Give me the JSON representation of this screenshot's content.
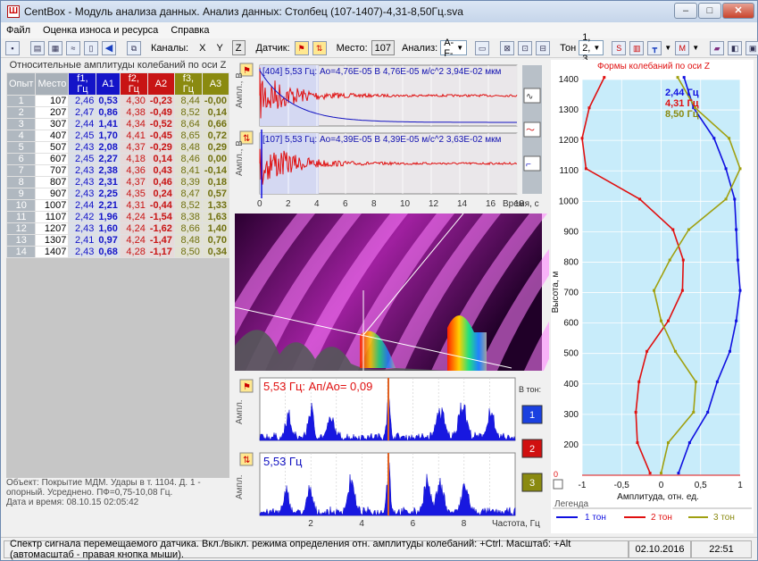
{
  "window": {
    "title": "CentBox - Модуль анализа данных. Анализ данных: Столбец (107-1407)-4,31-8,50Гц.sva",
    "app_icon": "Ш"
  },
  "menu": [
    "Файл",
    "Оценка износа и ресурса",
    "Справка"
  ],
  "toolbar": {
    "channels_label": "Каналы:",
    "ch_x": "X",
    "ch_y": "Y",
    "ch_z": "Z",
    "sensor_label": "Датчик:",
    "place_label": "Место:",
    "place_value": "107",
    "analysis_label": "Анализ:",
    "analysis_value": "A-F-",
    "tone_label": "Тон",
    "tone_value": "1, 2, 3"
  },
  "table": {
    "caption": "Относительные амплитуды колебаний по оси Z",
    "headers": [
      "Опыт",
      "Место",
      "f1, Гц",
      "A1",
      "f2, Гц",
      "A2",
      "f3, Гц",
      "A3"
    ],
    "rows": [
      [
        "1",
        "107",
        "2,46",
        "0,53",
        "4,30",
        "-0,23",
        "8,44",
        "-0,00"
      ],
      [
        "2",
        "207",
        "2,47",
        "0,86",
        "4,38",
        "-0,49",
        "8,52",
        "0,14"
      ],
      [
        "3",
        "307",
        "2,44",
        "1,41",
        "4,34",
        "-0,52",
        "8,64",
        "0,66"
      ],
      [
        "4",
        "407",
        "2,45",
        "1,70",
        "4,41",
        "-0,45",
        "8,65",
        "0,72"
      ],
      [
        "5",
        "507",
        "2,43",
        "2,08",
        "4,37",
        "-0,29",
        "8,48",
        "0,29"
      ],
      [
        "6",
        "607",
        "2,45",
        "2,27",
        "4,18",
        "0,14",
        "8,46",
        "0,00"
      ],
      [
        "7",
        "707",
        "2,43",
        "2,38",
        "4,36",
        "0,43",
        "8,41",
        "-0,14"
      ],
      [
        "8",
        "807",
        "2,43",
        "2,31",
        "4,37",
        "0,46",
        "8,39",
        "0,18"
      ],
      [
        "9",
        "907",
        "2,43",
        "2,25",
        "4,35",
        "0,24",
        "8,47",
        "0,57"
      ],
      [
        "10",
        "1007",
        "2,44",
        "2,21",
        "4,31",
        "-0,44",
        "8,52",
        "1,33"
      ],
      [
        "11",
        "1107",
        "2,42",
        "1,96",
        "4,24",
        "-1,54",
        "8,38",
        "1,63"
      ],
      [
        "12",
        "1207",
        "2,43",
        "1,60",
        "4,24",
        "-1,62",
        "8,66",
        "1,40"
      ],
      [
        "13",
        "1307",
        "2,41",
        "0,97",
        "4,24",
        "-1,47",
        "8,48",
        "0,70"
      ],
      [
        "14",
        "1407",
        "2,43",
        "0,68",
        "4,28",
        "-1,17",
        "8,50",
        "0,34"
      ]
    ]
  },
  "info": {
    "object": "Объект: Покрытие МДМ. Удары в т. 1104. Д. 1 - опорный. Усреднено. ПФ=0,75-10,08 Гц.",
    "datetime": "Дата и время: 08.10.15  02:05:42"
  },
  "wave": {
    "ylabel": "Ампл., В",
    "top_info": "[404] 5,53 Гц:  Ао=4,76Е-05  В    4,76Е-05  м/с^2    3,94Е-02  мкм",
    "bottom_info": "[107] 5,53 Гц:  Ао=4,39Е-05  В    4,39Е-05  м/с^2    3,63Е-02  мкм",
    "xticks": [
      "0",
      "2",
      "4",
      "6",
      "8",
      "10",
      "12",
      "14",
      "16",
      "18"
    ],
    "xlabel": "Время, с"
  },
  "spectrum": {
    "ylabel": "Ампл.",
    "top_info": "5,53 Гц:  Ап/Ао= 0,09",
    "bottom_info": "5,53 Гц",
    "xticks": [
      "2",
      "4",
      "6",
      "8"
    ],
    "xlabel": "Частота, Гц",
    "tone_label": "В тон:",
    "tone_buttons": [
      "1",
      "2",
      "3"
    ]
  },
  "modes": {
    "title": "Формы колебаний по оси Z",
    "ylabel": "Высота, м",
    "xlabel": "Амплитуда, отн. ед.",
    "freqs": [
      "2,44 Гц",
      "4,31 Гц",
      "8,50 Гц"
    ],
    "zero": "0",
    "legend_label": "Легенда",
    "legend": [
      "1 тон",
      "2 тон",
      "3 тон"
    ],
    "yticks": [
      "1400",
      "1300",
      "1200",
      "1100",
      "1000",
      "900",
      "800",
      "700",
      "600",
      "500",
      "400",
      "300",
      "200"
    ],
    "xticks": [
      "-1",
      "-0,5",
      "0",
      "0,5",
      "1"
    ]
  },
  "status": {
    "hint": "Спектр сигнала перемещаемого датчика. Вкл./выкл. режима определения отн. амплитуды колебаний: +Ctrl. Масштаб: +Alt (автомасштаб - правая кнопка мыши).",
    "date": "02.10.2016",
    "time": "22:51"
  },
  "chart_data": {
    "type": "line",
    "title": "Формы колебаний по оси Z",
    "xlabel": "Амплитуда, отн. ед.",
    "ylabel": "Высота, м",
    "xlim": [
      -1,
      1
    ],
    "ylim": [
      100,
      1400
    ],
    "heights": [
      107,
      207,
      307,
      407,
      507,
      607,
      707,
      807,
      907,
      1007,
      1107,
      1207,
      1307,
      1407
    ],
    "series": [
      {
        "name": "1 тон",
        "color": "#1010e0",
        "values": [
          0.22,
          0.36,
          0.59,
          0.71,
          0.87,
          0.95,
          1.0,
          0.97,
          0.95,
          0.93,
          0.82,
          0.67,
          0.41,
          0.29
        ]
      },
      {
        "name": "2 тон",
        "color": "#e01010",
        "values": [
          -0.14,
          -0.3,
          -0.32,
          -0.28,
          -0.18,
          0.09,
          0.27,
          0.28,
          0.15,
          -0.27,
          -0.95,
          -1.0,
          -0.91,
          -0.72
        ]
      },
      {
        "name": "3 тон",
        "color": "#a0a010",
        "values": [
          0.0,
          0.09,
          0.41,
          0.44,
          0.18,
          0.0,
          -0.09,
          0.11,
          0.35,
          0.82,
          1.0,
          0.86,
          0.43,
          0.21
        ]
      }
    ]
  }
}
